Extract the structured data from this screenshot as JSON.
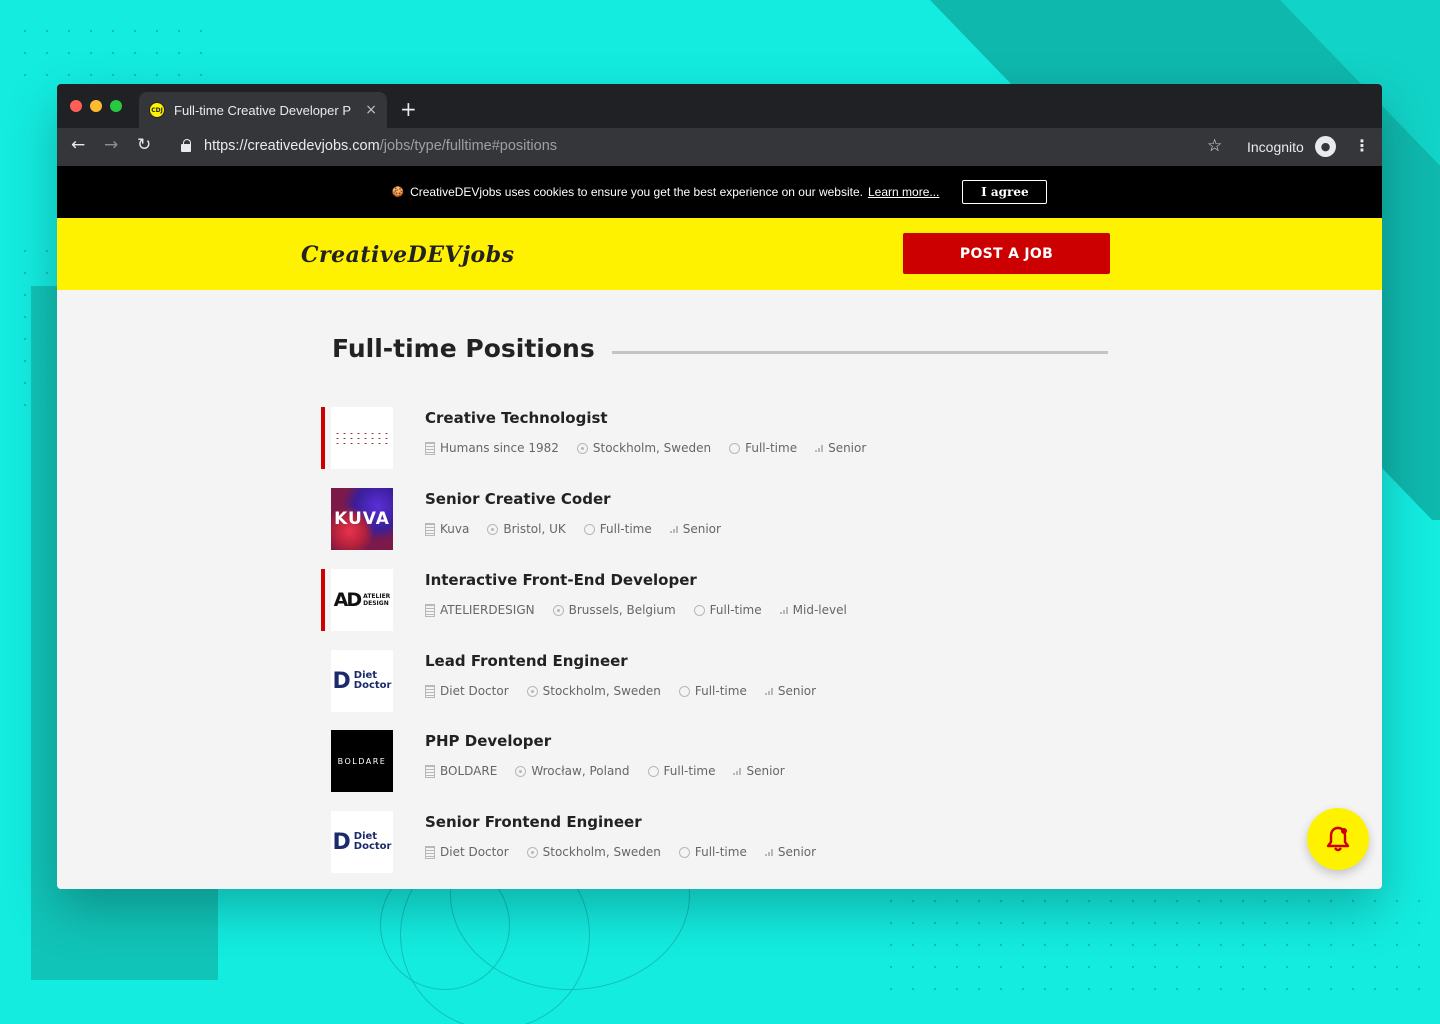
{
  "browser": {
    "tab_title": "Full-time Creative Developer P",
    "favicon_text": "CDJ",
    "tab_close": "×",
    "new_tab": "+",
    "url_domain": "https://creativedevjobs.com",
    "url_path": "/jobs/type/fulltime#positions",
    "incognito_label": "Incognito"
  },
  "cookie_bar": {
    "icon": "🍪",
    "message": "CreativeDEVjobs uses cookies to ensure you get the best experience on our website.",
    "link": "Learn more...",
    "agree_label": "I agree"
  },
  "header": {
    "logo_text": "CreativeDEVjobs",
    "post_job_label": "POST A JOB"
  },
  "page": {
    "title": "Full-time Positions"
  },
  "jobs": [
    {
      "title": "Creative Technologist",
      "company": "Humans since 1982",
      "location": "Stockholm, Sweden",
      "type": "Full-time",
      "level": "Senior",
      "featured": true,
      "logo": "humans-since-1982-logo"
    },
    {
      "title": "Senior Creative Coder",
      "company": "Kuva",
      "location": "Bristol, UK",
      "type": "Full-time",
      "level": "Senior",
      "featured": false,
      "logo": "kuva-logo",
      "logo_text": "KUVA"
    },
    {
      "title": "Interactive Front-End Developer",
      "company": "ATELIERDESIGN",
      "location": "Brussels, Belgium",
      "type": "Full-time",
      "level": "Mid-level",
      "featured": true,
      "logo": "atelier-design-logo",
      "logo_big": "AD",
      "logo_small_1": "ATELIER",
      "logo_small_2": "DESIGN"
    },
    {
      "title": "Lead Frontend Engineer",
      "company": "Diet Doctor",
      "location": "Stockholm, Sweden",
      "type": "Full-time",
      "level": "Senior",
      "featured": false,
      "logo": "diet-doctor-logo",
      "logo_l1": "Diet",
      "logo_l2": "Doctor"
    },
    {
      "title": "PHP Developer",
      "company": "BOLDARE",
      "location": "Wrocław, Poland",
      "type": "Full-time",
      "level": "Senior",
      "featured": false,
      "logo": "boldare-logo",
      "logo_text": "BOLDARE"
    },
    {
      "title": "Senior Frontend Engineer",
      "company": "Diet Doctor",
      "location": "Stockholm, Sweden",
      "type": "Full-time",
      "level": "Senior",
      "featured": false,
      "logo": "diet-doctor-logo",
      "logo_l1": "Diet",
      "logo_l2": "Doctor"
    }
  ],
  "colors": {
    "background": "#14ece0",
    "header_yellow": "#fff200",
    "accent_red": "#cc0000"
  }
}
